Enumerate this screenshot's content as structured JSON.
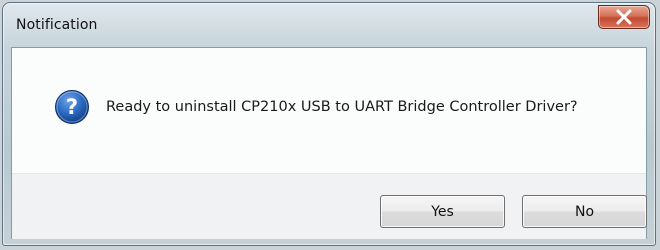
{
  "window": {
    "title": "Notification"
  },
  "message": {
    "icon": "question-icon",
    "text": "Ready to uninstall CP210x USB to UART Bridge Controller Driver?"
  },
  "buttons": {
    "yes_label": "Yes",
    "no_label": "No"
  },
  "title_buttons": {
    "close_icon": "close-icon",
    "close_color": "#c9543b"
  },
  "colors": {
    "question_icon_fill": "#1f5fb3",
    "dialog_frame": "#c4d1d8"
  }
}
